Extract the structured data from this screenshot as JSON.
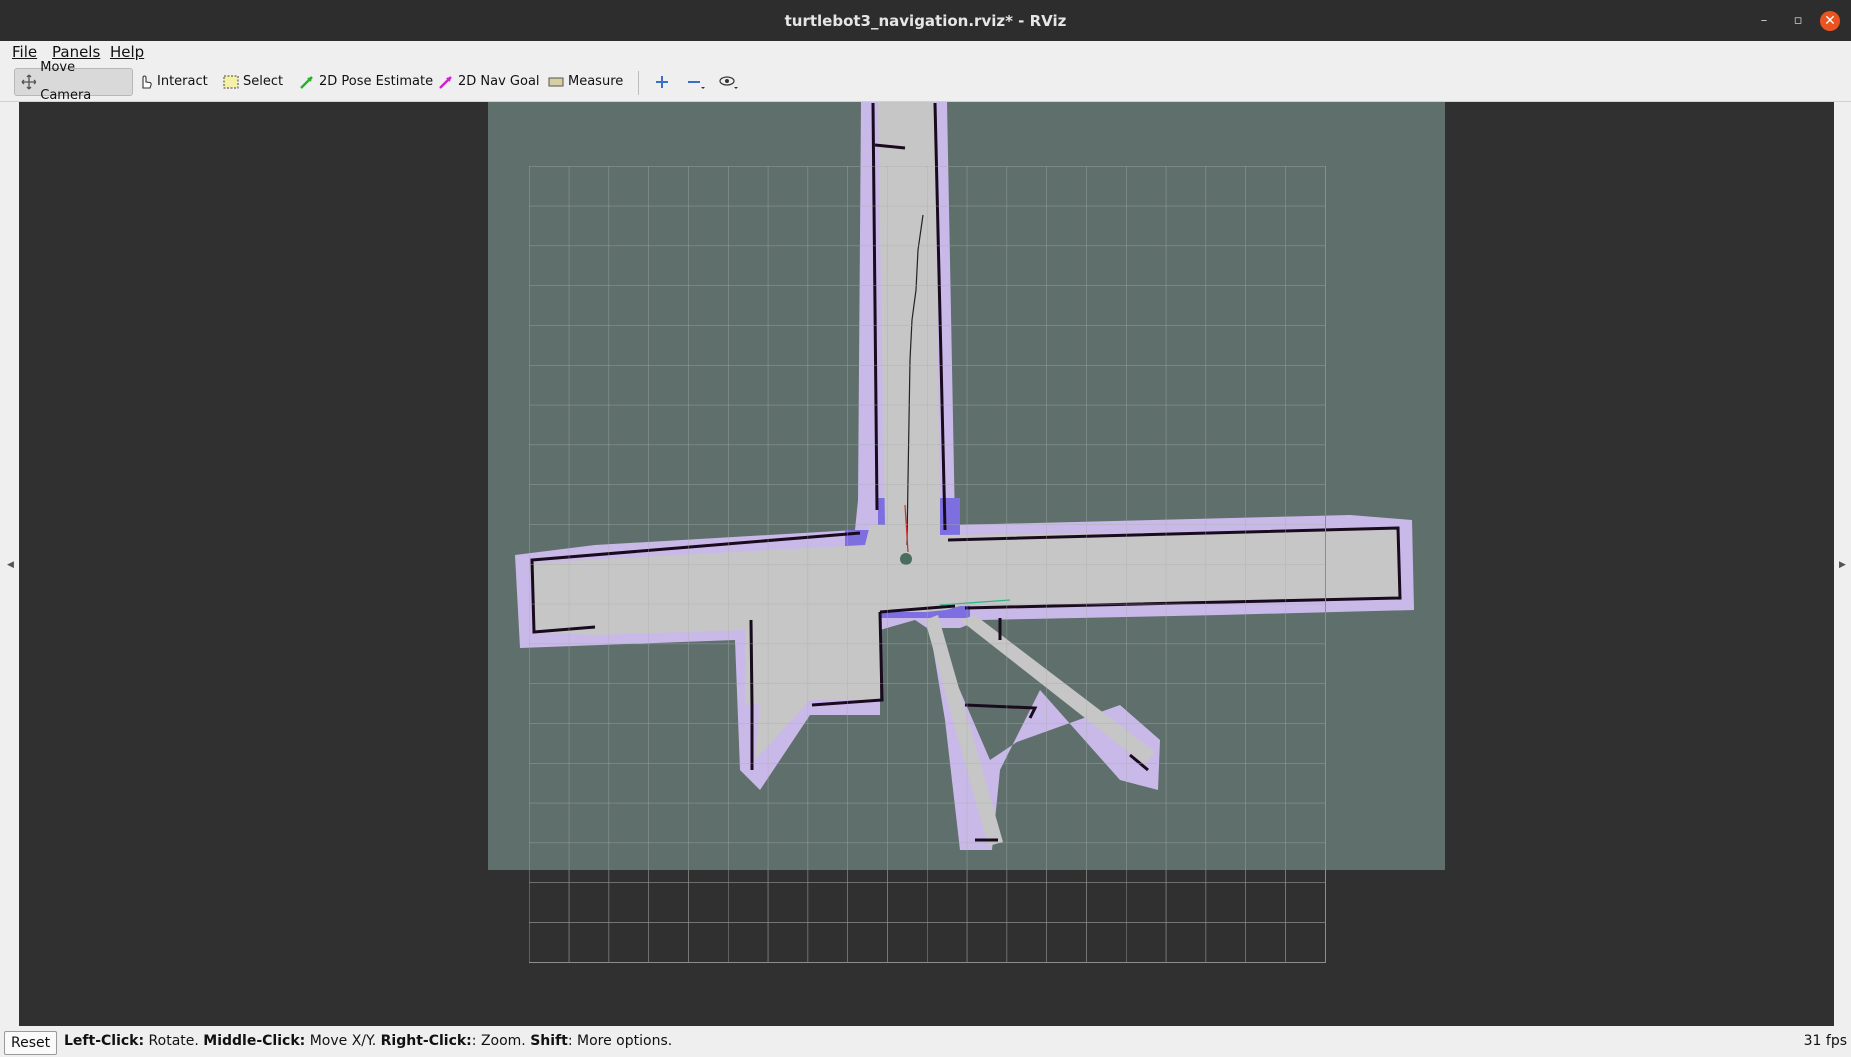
{
  "window": {
    "title": "turtlebot3_navigation.rviz* - RViz",
    "controls": {
      "minimize": "–",
      "maximize": "▫",
      "close": "✕"
    }
  },
  "menu": {
    "file": "File",
    "panels": "Panels",
    "help": "Help"
  },
  "toolbar": {
    "move_camera": "Move Camera",
    "interact": "Interact",
    "select": "Select",
    "pose_estimate": "2D Pose Estimate",
    "nav_goal": "2D Nav Goal",
    "measure": "Measure"
  },
  "colors": {
    "map_unknown": "#5f6f6c",
    "map_free": "#c6c6c6",
    "inflation": "#c9b9e8",
    "inflation_dark": "#7d6fe0",
    "obstacle": "#1a0a1e",
    "grid": "#a6aeab",
    "path": "#222222",
    "accent": "#e95420"
  },
  "status": {
    "reset": "Reset",
    "hint_left_key": "Left-Click:",
    "hint_left_val": " Rotate. ",
    "hint_middle_key": "Middle-Click:",
    "hint_middle_val": " Move X/Y. ",
    "hint_right_key": "Right-Click:",
    "hint_right_val": ": Zoom. ",
    "hint_shift_key": "Shift",
    "hint_shift_val": ": More options.",
    "fps": "31 fps"
  }
}
